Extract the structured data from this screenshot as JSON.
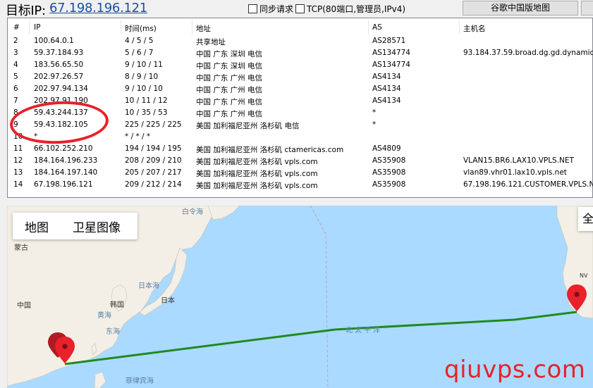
{
  "header": {
    "target_label": "目标IP:",
    "target_ip": "67.198.196.121",
    "sync_label": "同步请求",
    "tcp_label": "TCP(80端口,管理员,IPv4)",
    "map_button": "谷歌中国版地图"
  },
  "table": {
    "columns": [
      "#",
      "IP",
      "时间(ms)",
      "地址",
      "AS",
      "主机名"
    ],
    "rows": [
      [
        "2",
        "100.64.0.1",
        "4 / 5 / 5",
        "共享地址",
        "AS28571",
        ""
      ],
      [
        "3",
        "59.37.184.93",
        "5 / 6 / 7",
        "中国 广东 深圳 电信",
        "AS134774",
        "93.184.37.59.broad.dg.gd.dynamic..."
      ],
      [
        "4",
        "183.56.65.50",
        "9 / 10 / 11",
        "中国 广东 深圳 电信",
        "AS134774",
        ""
      ],
      [
        "5",
        "202.97.26.57",
        "8 / 9 / 10",
        "中国 广东 广州 电信",
        "AS4134",
        ""
      ],
      [
        "6",
        "202.97.94.134",
        "9 / 10 / 10",
        "中国 广东 广州 电信",
        "AS4134",
        ""
      ],
      [
        "7",
        "202.97.91.190",
        "10 / 11 / 12",
        "中国 广东 广州 电信",
        "AS4134",
        ""
      ],
      [
        "8",
        "59.43.244.137",
        "10 / 35 / 53",
        "中国 广东 广州 电信",
        "*",
        ""
      ],
      [
        "9",
        "59.43.182.105",
        "225 / 225 / 225",
        "美国 加利福尼亚州 洛杉矶 电信",
        "*",
        ""
      ],
      [
        "10",
        "*",
        "* / * / *",
        "",
        "",
        ""
      ],
      [
        "11",
        "66.102.252.210",
        "194 / 194 / 195",
        "美国 加利福尼亚州 洛杉矶 ctamericas.com",
        "AS4809",
        ""
      ],
      [
        "12",
        "184.164.196.233",
        "208 / 209 / 210",
        "美国 加利福尼亚州 洛杉矶 vpls.com",
        "AS35908",
        "VLAN15.BR6.LAX10.VPLS.NET"
      ],
      [
        "13",
        "184.164.197.140",
        "205 / 207 / 217",
        "美国 加利福尼亚州 洛杉矶 vpls.com",
        "AS35908",
        "vlan89.vhr01.lax10.vpls.net"
      ],
      [
        "14",
        "67.198.196.121",
        "209 / 212 / 214",
        "美国 加利福尼亚州 洛杉矶 vpls.com",
        "AS35908",
        "67.198.196.121.CUSTOMER.VPLS.NET"
      ]
    ]
  },
  "map": {
    "tab_map": "地图",
    "tab_satellite": "卫星图像",
    "fullscreen": "全",
    "labels": {
      "bering": "白令海",
      "mongolia": "蒙古",
      "china": "中国",
      "korea": "韩国",
      "japan": "日本",
      "sea_of_japan": "日本海",
      "yellow_sea": "黄海",
      "east_sea": "东海",
      "north_pacific": "北太平洋",
      "philippine_sea": "菲律宾海",
      "nv": "NV"
    },
    "route_color": "#1e8a1e",
    "marker_color": "#e8212a"
  },
  "watermark": "qiuvps.com"
}
